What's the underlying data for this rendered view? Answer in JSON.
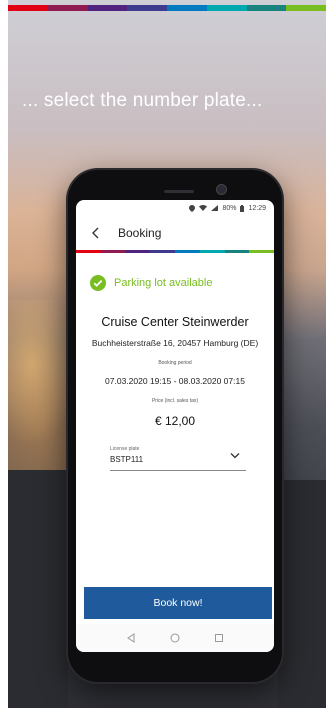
{
  "headline": "... select the number plate...",
  "brand_colors": [
    "#e20015",
    "#8f1b52",
    "#50237f",
    "#3e3b8f",
    "#007bc0",
    "#00a8b0",
    "#18837e",
    "#78be20"
  ],
  "app": {
    "status_bar": {
      "battery": "80%",
      "time": "12:29"
    },
    "title": "Booking",
    "availability": {
      "text": "Parking lot available",
      "color": "#78be20",
      "icon": "check-circle-icon"
    },
    "location": {
      "name": "Cruise Center Steinwerder",
      "address": "Buchheisterstraße 16, 20457 Hamburg (DE)"
    },
    "booking_period": {
      "label": "Booking period",
      "value": "07.03.2020 19:15 - 08.03.2020 07:15"
    },
    "price": {
      "label": "Price (incl. sales tax)",
      "value": "€ 12,00"
    },
    "license_plate": {
      "label": "License plate",
      "value": "BSTP111"
    },
    "book_button": "Book now!",
    "book_button_color": "#1e5a9c"
  }
}
